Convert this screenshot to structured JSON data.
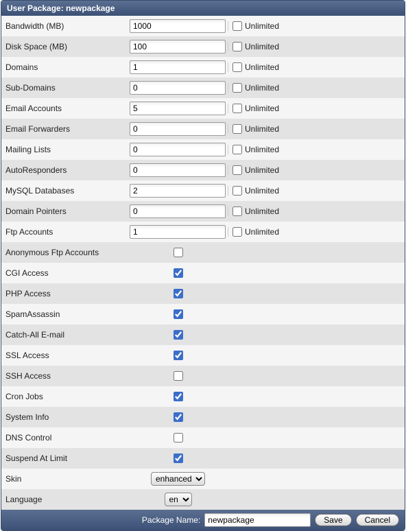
{
  "header": {
    "title": "User Package: newpackage"
  },
  "unlimited_label": "Unlimited",
  "quota_rows": [
    {
      "label": "Bandwidth (MB)",
      "value": "1000",
      "unlimited": false
    },
    {
      "label": "Disk Space (MB)",
      "value": "100",
      "unlimited": false
    },
    {
      "label": "Domains",
      "value": "1",
      "unlimited": false
    },
    {
      "label": "Sub-Domains",
      "value": "0",
      "unlimited": false
    },
    {
      "label": "Email Accounts",
      "value": "5",
      "unlimited": false
    },
    {
      "label": "Email Forwarders",
      "value": "0",
      "unlimited": false
    },
    {
      "label": "Mailing Lists",
      "value": "0",
      "unlimited": false
    },
    {
      "label": "AutoResponders",
      "value": "0",
      "unlimited": false
    },
    {
      "label": "MySQL Databases",
      "value": "2",
      "unlimited": false
    },
    {
      "label": "Domain Pointers",
      "value": "0",
      "unlimited": false
    },
    {
      "label": "Ftp Accounts",
      "value": "1",
      "unlimited": false
    }
  ],
  "feature_rows": [
    {
      "label": "Anonymous Ftp Accounts",
      "checked": false
    },
    {
      "label": "CGI Access",
      "checked": true
    },
    {
      "label": "PHP Access",
      "checked": true
    },
    {
      "label": "SpamAssassin",
      "checked": true
    },
    {
      "label": "Catch-All E-mail",
      "checked": true
    },
    {
      "label": "SSL Access",
      "checked": true
    },
    {
      "label": "SSH Access",
      "checked": false
    },
    {
      "label": "Cron Jobs",
      "checked": true
    },
    {
      "label": "System Info",
      "checked": true
    },
    {
      "label": "DNS Control",
      "checked": false
    },
    {
      "label": "Suspend At Limit",
      "checked": true
    }
  ],
  "select_rows": [
    {
      "label": "Skin",
      "value": "enhanced",
      "options": [
        "enhanced"
      ]
    },
    {
      "label": "Language",
      "value": "en",
      "options": [
        "en"
      ]
    }
  ],
  "footer": {
    "label": "Package Name:",
    "value": "newpackage",
    "save": "Save",
    "cancel": "Cancel"
  }
}
